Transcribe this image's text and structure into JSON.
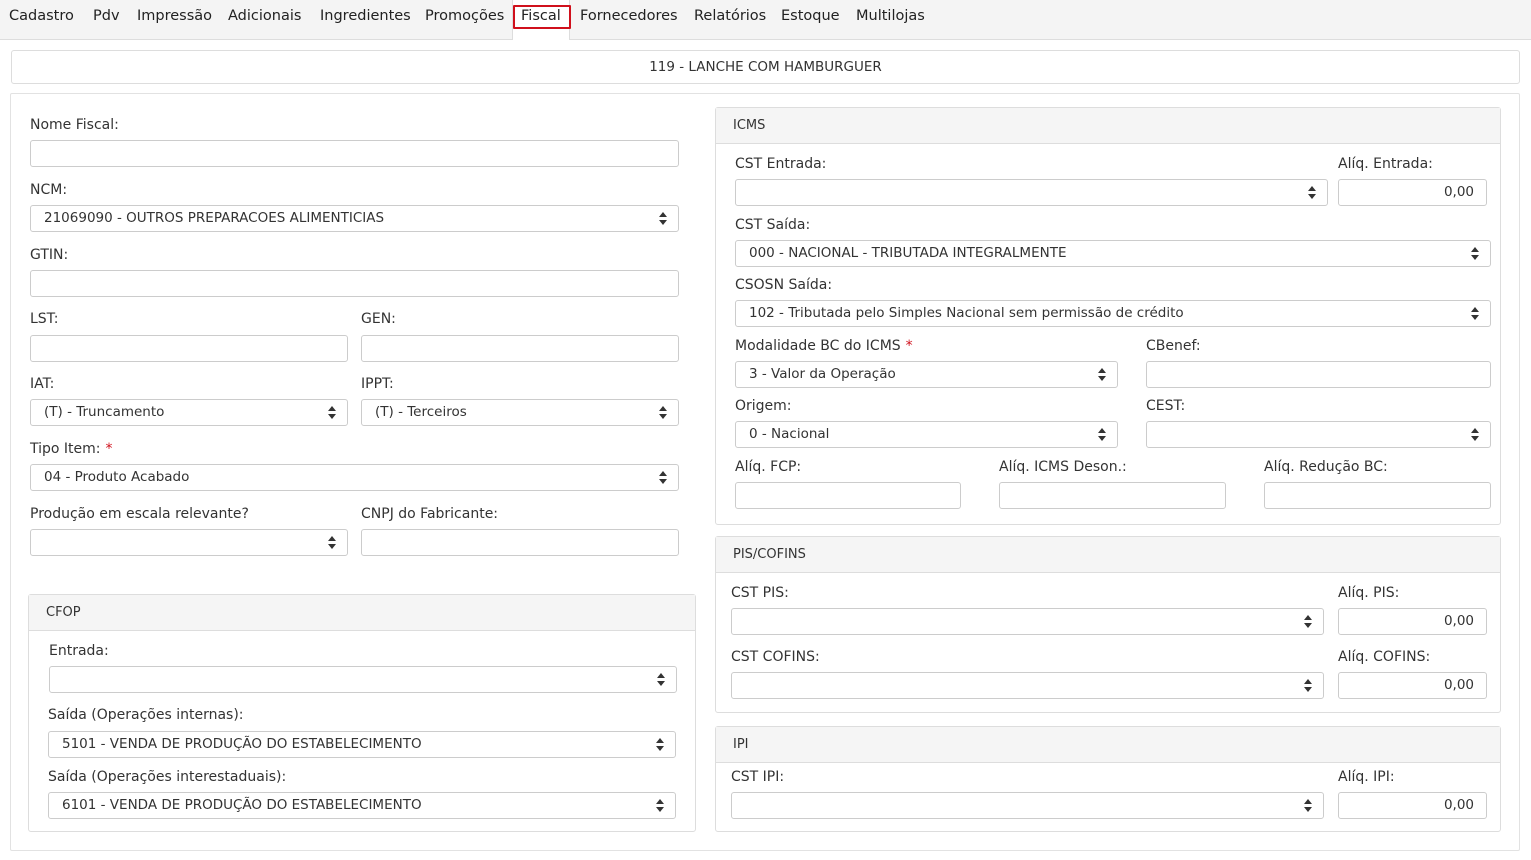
{
  "tabs": [
    {
      "label": "Cadastro"
    },
    {
      "label": "Pdv"
    },
    {
      "label": "Impressão"
    },
    {
      "label": "Adicionais"
    },
    {
      "label": "Ingredientes"
    },
    {
      "label": "Promoções"
    },
    {
      "label": "Fiscal"
    },
    {
      "label": "Fornecedores"
    },
    {
      "label": "Relatórios"
    },
    {
      "label": "Estoque"
    },
    {
      "label": "Multilojas"
    }
  ],
  "active_tab": "Fiscal",
  "product_title": "119 - LANCHE COM HAMBURGUER",
  "left": {
    "nome_fiscal": {
      "label": "Nome Fiscal:",
      "value": ""
    },
    "ncm": {
      "label": "NCM:",
      "value": "21069090 - OUTROS PREPARACOES ALIMENTICIAS"
    },
    "gtin": {
      "label": "GTIN:",
      "value": ""
    },
    "lst": {
      "label": "LST:",
      "value": ""
    },
    "gen": {
      "label": "GEN:",
      "value": ""
    },
    "iat": {
      "label": "IAT:",
      "value": "(T) - Truncamento"
    },
    "ippt": {
      "label": "IPPT:",
      "value": "(T) - Terceiros"
    },
    "tipo_item": {
      "label": "Tipo Item:",
      "required": "*",
      "value": "04 - Produto Acabado"
    },
    "producao": {
      "label": "Produção em escala relevante?",
      "value": ""
    },
    "cnpj": {
      "label": "CNPJ do Fabricante:",
      "value": ""
    }
  },
  "cfop": {
    "title": "CFOP",
    "entrada": {
      "label": "Entrada:",
      "value": ""
    },
    "saida_internas": {
      "label": "Saída (Operações internas):",
      "value": "5101 - VENDA DE PRODUÇÃO DO ESTABELECIMENTO"
    },
    "saida_interestaduais": {
      "label": "Saída (Operações interestaduais):",
      "value": "6101 - VENDA DE PRODUÇÃO DO ESTABELECIMENTO"
    }
  },
  "icms": {
    "title": "ICMS",
    "cst_entrada": {
      "label": "CST Entrada:",
      "value": ""
    },
    "aliq_entrada": {
      "label": "Alíq. Entrada:",
      "value": "0,00"
    },
    "cst_saida": {
      "label": "CST Saída:",
      "value": "000 - NACIONAL - TRIBUTADA INTEGRALMENTE"
    },
    "csosn_saida": {
      "label": "CSOSN Saída:",
      "value": "102 - Tributada pelo Simples Nacional sem permissão de crédito"
    },
    "modalidade": {
      "label": "Modalidade BC do ICMS",
      "required": "*",
      "value": "3 - Valor da Operação"
    },
    "cbenef": {
      "label": "CBenef:",
      "value": ""
    },
    "origem": {
      "label": "Origem:",
      "value": "0 - Nacional"
    },
    "cest": {
      "label": "CEST:",
      "value": ""
    },
    "aliq_fcp": {
      "label": "Alíq. FCP:",
      "value": ""
    },
    "aliq_deson": {
      "label": "Alíq. ICMS Deson.:",
      "value": ""
    },
    "aliq_reducao": {
      "label": "Alíq. Redução BC:",
      "value": ""
    }
  },
  "pis_cofins": {
    "title": "PIS/COFINS",
    "cst_pis": {
      "label": "CST PIS:",
      "value": ""
    },
    "aliq_pis": {
      "label": "Alíq. PIS:",
      "value": "0,00"
    },
    "cst_cofins": {
      "label": "CST COFINS:",
      "value": ""
    },
    "aliq_cofins": {
      "label": "Alíq. COFINS:",
      "value": "0,00"
    }
  },
  "ipi": {
    "title": "IPI",
    "cst_ipi": {
      "label": "CST IPI:",
      "value": ""
    },
    "aliq_ipi": {
      "label": "Alíq. IPI:",
      "value": "0,00"
    }
  },
  "colors": {
    "active_tab_outline": "#d0101c",
    "required_marker": "#d0101c"
  }
}
